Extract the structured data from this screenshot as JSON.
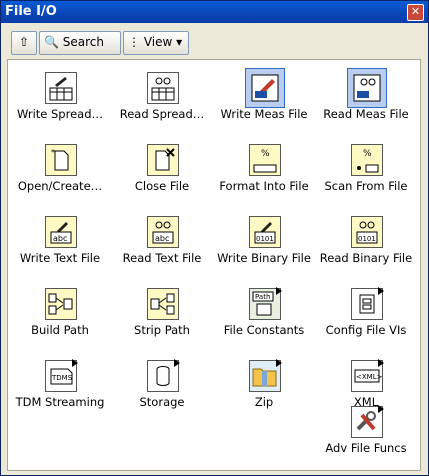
{
  "window": {
    "title": "File I/O"
  },
  "toolbar": {
    "search_label": "Search",
    "view_label": "View"
  },
  "items": [
    {
      "label": "Write Spread…"
    },
    {
      "label": "Read Spread…"
    },
    {
      "label": "Write Meas File"
    },
    {
      "label": "Read Meas File"
    },
    {
      "label": "Open/Create…"
    },
    {
      "label": "Close File"
    },
    {
      "label": "Format Into File"
    },
    {
      "label": "Scan From File"
    },
    {
      "label": "Write Text File"
    },
    {
      "label": "Read Text File"
    },
    {
      "label": "Write Binary File"
    },
    {
      "label": "Read Binary File"
    },
    {
      "label": "Build Path"
    },
    {
      "label": "Strip Path"
    },
    {
      "label": "File Constants"
    },
    {
      "label": "Config File VIs"
    },
    {
      "label": "TDM Streaming"
    },
    {
      "label": "Storage"
    },
    {
      "label": "Zip"
    },
    {
      "label": "XML"
    },
    {
      "label": "Adv File Funcs"
    }
  ],
  "icon_text": {
    "abc": "abc",
    "bin": "0101",
    "percent": "%",
    "path": "Path",
    "tdms": "TDMS",
    "xml": "<XML>"
  },
  "colors": {
    "titlebar": "#0a46b8",
    "selected": "#b8cdf0",
    "icon_bg": "#fff9c4"
  }
}
